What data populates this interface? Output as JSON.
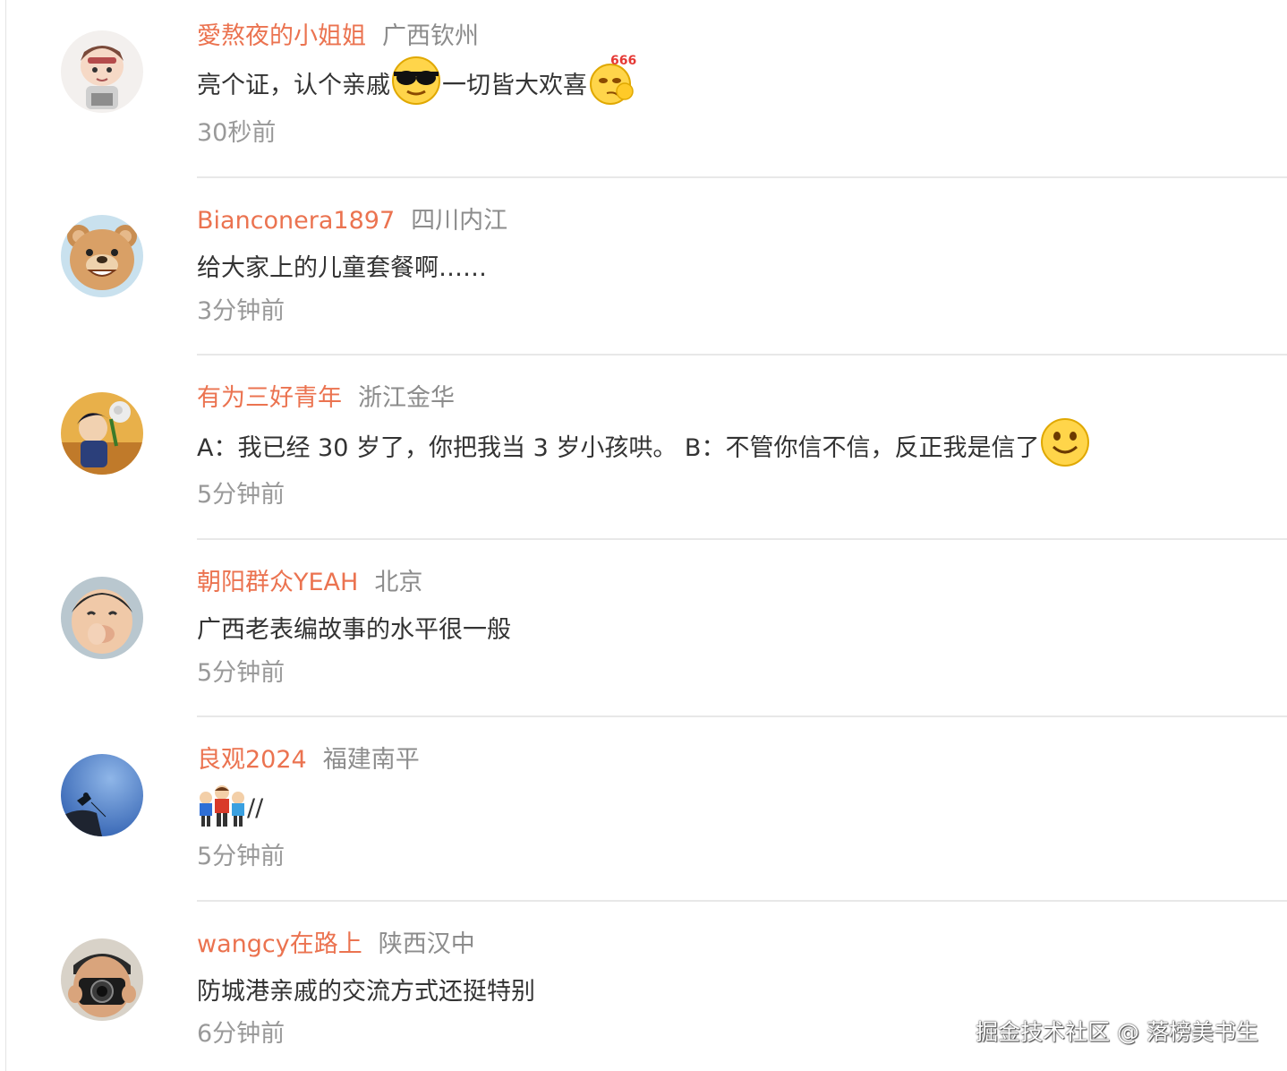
{
  "comments": [
    {
      "username": "愛熬夜的小姐姐",
      "location": "广西钦州",
      "text_parts": [
        "亮个证，认个亲戚",
        "一切皆大欢喜"
      ],
      "emojis": [
        "cool-sunglasses-emoji",
        "666-thinking-emoji"
      ],
      "time": "30秒前"
    },
    {
      "username": "Bianconera1897",
      "location": "四川内江",
      "text_parts": [
        "给大家上的儿童套餐啊……"
      ],
      "emojis": [],
      "time": "3分钟前"
    },
    {
      "username": "有为三好青年",
      "location": "浙江金华",
      "text_parts": [
        "A：我已经 30 岁了，你把我当 3 岁小孩哄。 B：不管你信不信，反正我是信了"
      ],
      "emojis": [
        "smile-emoji"
      ],
      "time": "5分钟前"
    },
    {
      "username": "朝阳群众YEAH",
      "location": "北京",
      "text_parts": [
        "广西老表编故事的水平很一般"
      ],
      "emojis": [],
      "time": "5分钟前"
    },
    {
      "username": "良观2024",
      "location": "福建南平",
      "text_parts": [
        "//"
      ],
      "emojis": [
        "three-people-emoji"
      ],
      "time": "5分钟前"
    },
    {
      "username": "wangcy在路上",
      "location": "陕西汉中",
      "text_parts": [
        "防城港亲戚的交流方式还挺特别"
      ],
      "emojis": [],
      "time": "6分钟前"
    }
  ],
  "watermark": "掘金技术社区 @ 落榜美书生",
  "colors": {
    "username": "#eb7350",
    "location": "#8c8c8c",
    "body_text": "#333333",
    "time": "#999999",
    "divider": "#e8e8e8"
  }
}
